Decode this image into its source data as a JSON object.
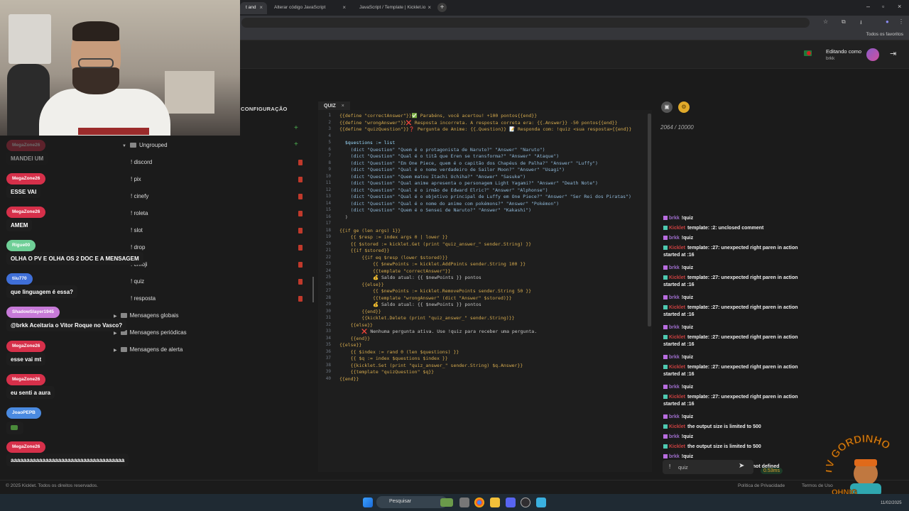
{
  "browser": {
    "tabs": [
      {
        "label": "t and"
      },
      {
        "label": "Alterar código JavaScript"
      },
      {
        "label": "JavaScript / Template | Kicklet.io"
      }
    ],
    "new_tab": "+",
    "bookmarks_label": "Todos os favoritos"
  },
  "header": {
    "editing_label": "Editando como",
    "username": "brkk"
  },
  "sidebar": {
    "config_label": "CONFIGURAÇÃO",
    "group_ungrouped": "Ungrouped",
    "commands": [
      "! discord",
      "! pix",
      "! cinefy",
      "! roleta",
      "! slot",
      "! drop",
      "! emoji",
      "! quiz",
      "! resposta"
    ],
    "folders": [
      "Mensagens globais",
      "Mensagens periódicas",
      "Mensagens de alerta"
    ]
  },
  "chat_overlay": [
    {
      "name": "MegaZone26",
      "text": "MANDEI UM",
      "color": "#d6304a"
    },
    {
      "name": "MegaZone26",
      "text": "ESSE VAI",
      "color": "#d6304a"
    },
    {
      "name": "MegaZone26",
      "text": "AMEM",
      "color": "#d6304a"
    },
    {
      "name": "Rigue00",
      "text": "OLHA O PV E OLHA OS 2 DOC E A MENSAGEM",
      "color": "#6fcf97"
    },
    {
      "name": "tiiu770",
      "text": "que linguagem é essa?",
      "color": "#3f6fd8"
    },
    {
      "name": "ShadowSlayer1945",
      "text": "@brkk Aceitaria o Vitor Roque no Vasco?",
      "color": "#c77ad8"
    },
    {
      "name": "MegaZone26",
      "text": "esse vai mt",
      "color": "#d6304a"
    },
    {
      "name": "MegaZone26",
      "text": "eu senti a aura",
      "color": "#d6304a"
    },
    {
      "name": "JoaoPEPB",
      "text": "",
      "color": "#4a8ae0"
    },
    {
      "name": "MegaZone26",
      "text": "aaaaaaaaaaaaaaaaaaaaaaaaaaaaaaaaaaaa",
      "color": "#d6304a"
    }
  ],
  "editor": {
    "tab_label": "QUIZ",
    "line_numbers": [
      "1",
      "2",
      "3",
      "4",
      "5",
      "6",
      "7",
      "8",
      "9",
      "10",
      "11",
      "12",
      "13",
      "14",
      "15",
      "16",
      "17",
      "18",
      "19",
      "20",
      "21",
      "22",
      "23",
      "24",
      "25",
      "26",
      "27",
      "28",
      "29",
      "30",
      "31",
      "32",
      "33",
      "34",
      "35",
      "36",
      "37",
      "38",
      "39",
      "40"
    ],
    "lines": [
      "{{define \"correctAnswer\"}}✅ Parabéns, você acertou! +100 pontos{{end}}",
      "{{define \"wrongAnswer\"}}❌ Resposta incorreta. A resposta correta era: {{.Answer}} -50 pontos{{end}}",
      "{{define \"quizQuestion\"}}❓ Pergunta de Anime: {{.Question}} 📝 Responda com: !quiz <sua resposta>{{end}}",
      "",
      "  $questions := list",
      "    (dict \"Question\" \"Quem é o protagonista de Naruto?\" \"Answer\" \"Naruto\")",
      "    (dict \"Question\" \"Qual é o titã que Eren se transforma?\" \"Answer\" \"Ataque\")",
      "    (dict \"Question\" \"Em One Piece, quem é o capitão dos Chapéus de Palha?\" \"Answer\" \"Luffy\")",
      "    (dict \"Question\" \"Qual é o nome verdadeiro de Sailor Moon?\" \"Answer\" \"Usagi\")",
      "    (dict \"Question\" \"Quem matou Itachi Uchiha?\" \"Answer\" \"Sasuke\")",
      "    (dict \"Question\" \"Qual anime apresenta o personagem Light Yagami?\" \"Answer\" \"Death Note\")",
      "    (dict \"Question\" \"Qual é o irmão de Edward Elric?\" \"Answer\" \"Alphonse\")",
      "    (dict \"Question\" \"Qual é o objetivo principal de Luffy em One Piece?\" \"Answer\" \"Ser Rei dos Piratas\")",
      "    (dict \"Question\" \"Qual é o nome do anime com pokémons?\" \"Answer\" \"Pokémon\")",
      "    (dict \"Question\" \"Quem é o Sensei de Naruto?\" \"Answer\" \"Kakashi\")",
      "  )",
      "",
      "{{if ge (len args) 1}}",
      "    {{ $resp := index args 0 | lower }}",
      "    {{ $stored := kicklet.Get (print \"quiz_answer_\" sender.String) }}",
      "    {{if $stored}}",
      "        {{if eq $resp (lower $stored)}}",
      "            {{ $newPoints := kicklet.AddPoints sender.String 100 }}",
      "            {{template \"correctAnswer\"}}",
      "            💰 Saldo atual: {{ $newPoints }} pontos",
      "        {{else}}",
      "            {{ $newPoints := kicklet.RemovePoints sender.String 50 }}",
      "            {{template \"wrongAnswer\" (dict \"Answer\" $stored)}}",
      "            💰 Saldo atual: {{ $newPoints }} pontos",
      "        {{end}}",
      "        {{kicklet.Delete (print \"quiz_answer_\" sender.String)}}",
      "    {{else}}",
      "        ❌ Nenhuma pergunta ativa. Use !quiz para receber uma pergunta.",
      "    {{end}}",
      "{{else}}",
      "    {{ $index := rand 0 (len $questions) }}",
      "    {{ $q := index $questions $index }}",
      "    {{kicklet.Set (print \"quiz_answer_\" sender.String) $q.Answer}}",
      "    {{template \"quizQuestion\" $q}}",
      "{{end}}"
    ]
  },
  "right_panel": {
    "char_count": "2064 / 10000",
    "log": [
      {
        "user": "brkk",
        "text": "!quiz",
        "kind": "user"
      },
      {
        "user": "Kicklet",
        "text": "template: :2: unclosed comment",
        "kind": "bot"
      },
      {
        "user": "brkk",
        "text": "!quiz",
        "kind": "user"
      },
      {
        "user": "Kicklet",
        "text": "template: :27: unexpected right paren in action started at :16",
        "kind": "bot"
      },
      {
        "user": "brkk",
        "text": "!quiz",
        "kind": "user"
      },
      {
        "user": "Kicklet",
        "text": "template: :27: unexpected right paren in action started at :16",
        "kind": "bot"
      },
      {
        "user": "brkk",
        "text": "!quiz",
        "kind": "user"
      },
      {
        "user": "Kicklet",
        "text": "template: :27: unexpected right paren in action started at :16",
        "kind": "bot"
      },
      {
        "user": "brkk",
        "text": "!quiz",
        "kind": "user"
      },
      {
        "user": "Kicklet",
        "text": "template: :27: unexpected right paren in action started at :16",
        "kind": "bot"
      },
      {
        "user": "brkk",
        "text": "!quiz",
        "kind": "user"
      },
      {
        "user": "Kicklet",
        "text": "template: :27: unexpected right paren in action started at :16",
        "kind": "bot"
      },
      {
        "user": "brkk",
        "text": "!quiz",
        "kind": "user"
      },
      {
        "user": "Kicklet",
        "text": "template: :27: unexpected right paren in action started at :16",
        "kind": "bot"
      },
      {
        "user": "brkk",
        "text": "!quiz",
        "kind": "user"
      },
      {
        "user": "Kicklet",
        "text": "the output size is limited to 500",
        "kind": "bot"
      },
      {
        "user": "brkk",
        "text": "!quiz",
        "kind": "user"
      },
      {
        "user": "Kicklet",
        "text": "the output size is limited to 500",
        "kind": "bot"
      },
      {
        "user": "brkk",
        "text": "!quiz",
        "kind": "user"
      },
      {
        "user": "Kicklet",
        "text": "template: :5: function \"list\" not defined",
        "kind": "bot"
      }
    ],
    "input_prefix": "!",
    "input_value": "quiz",
    "latency": "0.53ms"
  },
  "footer": {
    "copyright": "© 2025 Kicklet. Todos os direitos reservados.",
    "privacy": "Política de Privacidade",
    "terms": "Termos de Uso"
  },
  "taskbar": {
    "search_placeholder": "Pesquisar",
    "date": "11/02/2025"
  },
  "watermark": {
    "text_top": "TV GORDINHO",
    "text_bottom": "OHNIG"
  }
}
